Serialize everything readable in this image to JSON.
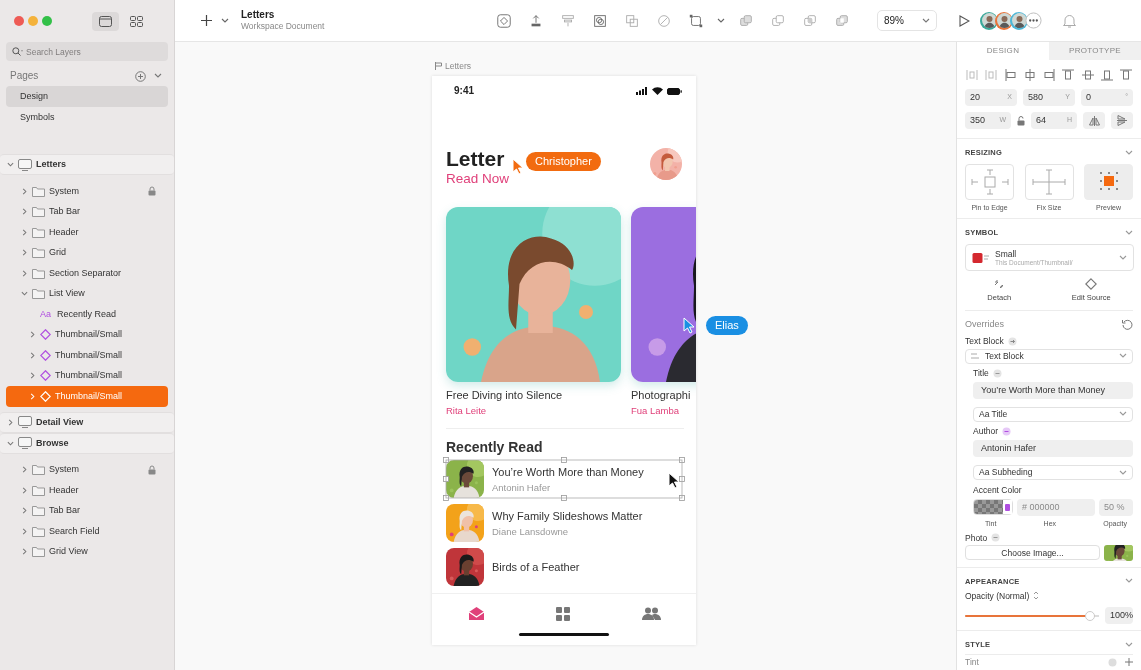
{
  "sidebar": {
    "search": {
      "placeholder": "Search Layers"
    },
    "pages_title": "Pages",
    "pages": [
      {
        "label": "Design",
        "selected": true
      },
      {
        "label": "Symbols",
        "selected": false
      }
    ],
    "layers": [
      {
        "name": "Letters",
        "kind": "artboard",
        "expanded": true,
        "selected": false,
        "locked": false,
        "children": [
          {
            "name": "System",
            "kind": "group",
            "expanded": false,
            "selected": false,
            "locked": true
          },
          {
            "name": "Tab Bar",
            "kind": "group",
            "expanded": false,
            "selected": false,
            "locked": false
          },
          {
            "name": "Header",
            "kind": "group",
            "expanded": false,
            "selected": false,
            "locked": false
          },
          {
            "name": "Grid",
            "kind": "group",
            "expanded": false,
            "selected": false,
            "locked": false
          },
          {
            "name": "Section Separator",
            "kind": "group",
            "expanded": false,
            "selected": false,
            "locked": false
          },
          {
            "name": "List View",
            "kind": "group",
            "expanded": true,
            "selected": false,
            "locked": false,
            "children": [
              {
                "name": "Recently Read",
                "kind": "text",
                "glyph": "Aa",
                "selected": false,
                "locked": false
              },
              {
                "name": "Thumbnail/Small",
                "kind": "symbol",
                "expanded": false,
                "selected": false,
                "locked": false
              },
              {
                "name": "Thumbnail/Small",
                "kind": "symbol",
                "expanded": false,
                "selected": false,
                "locked": false
              },
              {
                "name": "Thumbnail/Small",
                "kind": "symbol",
                "expanded": false,
                "selected": false,
                "locked": false
              },
              {
                "name": "Thumbnail/Small",
                "kind": "symbol",
                "expanded": false,
                "selected": true,
                "locked": false
              }
            ]
          }
        ]
      },
      {
        "name": "Detail View",
        "kind": "artboard",
        "expanded": false,
        "selected": false,
        "locked": false
      },
      {
        "name": "Browse",
        "kind": "artboard",
        "expanded": true,
        "selected": false,
        "locked": false,
        "children": [
          {
            "name": "System",
            "kind": "group",
            "expanded": false,
            "selected": false,
            "locked": true
          },
          {
            "name": "Header",
            "kind": "group",
            "expanded": false,
            "selected": false,
            "locked": false
          },
          {
            "name": "Tab Bar",
            "kind": "group",
            "expanded": false,
            "selected": false,
            "locked": false
          },
          {
            "name": "Search Field",
            "kind": "group",
            "expanded": false,
            "selected": false,
            "locked": false
          },
          {
            "name": "Grid View",
            "kind": "group",
            "expanded": false,
            "selected": false,
            "locked": false
          }
        ]
      }
    ]
  },
  "toolbar": {
    "document_title": "Letters",
    "document_subtitle": "Workspace Document",
    "zoom": "89%",
    "collaborators": [
      {
        "color": "#3aa89a"
      },
      {
        "color": "#e8743a"
      },
      {
        "color": "#4cb6d6"
      }
    ]
  },
  "canvas": {
    "artboard_title": "Letters",
    "phone": {
      "time": "9:41",
      "heading": "Letter",
      "subheading": "Read Now",
      "featured": [
        {
          "title": "Free Diving into Silence",
          "author": "Rita Leite"
        },
        {
          "title": "Photographi",
          "author": "Fua Lamba"
        }
      ],
      "section_title": "Recently Read",
      "list": [
        {
          "title": "You’re Worth More than Money",
          "author": "Antonin Hafer",
          "selected": true
        },
        {
          "title": "Why Family Slideshows Matter",
          "author": "Diane Lansdowne",
          "selected": false
        },
        {
          "title": "Birds of a Feather",
          "selected": false
        }
      ],
      "tabs": [
        {
          "kind": "envelope",
          "selected": true
        },
        {
          "kind": "grid",
          "selected": false
        },
        {
          "kind": "people",
          "selected": false
        }
      ]
    },
    "cursors": [
      {
        "name": "Christopher",
        "color": "#f26b0f"
      },
      {
        "name": "Elias",
        "color": "#1a8fe3"
      }
    ]
  },
  "inspector": {
    "tabs": [
      {
        "label": "DESIGN",
        "selected": true
      },
      {
        "label": "PROTOTYPE",
        "selected": false
      }
    ],
    "position": [
      {
        "value": "20",
        "unit": "X"
      },
      {
        "value": "580",
        "unit": "Y"
      },
      {
        "value": "0",
        "unit": "°"
      }
    ],
    "size": [
      {
        "value": "350",
        "unit": "W"
      },
      {
        "value": "64",
        "unit": "H"
      }
    ],
    "proportions_locked": false,
    "resizing": {
      "title": "RESIZING",
      "options": [
        "Pin to Edge",
        "Fix Size",
        "Preview"
      ]
    },
    "symbol": {
      "title": "SYMBOL",
      "name": "Small",
      "path": "This Document/Thumbnail/",
      "actions": [
        "Detach",
        "Edit Source"
      ]
    },
    "overrides": {
      "title": "Overrides",
      "text_block_label": "Text Block",
      "text_block_value": "Text Block",
      "fields": [
        {
          "label": "Title",
          "value": "You’re Worth More than Money",
          "style": "Aa Title",
          "highlighted": false
        },
        {
          "label": "Author",
          "value": "Antonin Hafer",
          "style": "Aa Subheding",
          "highlighted": true
        }
      ],
      "accent": {
        "label": "Accent Color",
        "hex_placeholder": "# 000000",
        "opacity_placeholder": "50 %",
        "captions": [
          "Tint",
          "Hex",
          "Opacity"
        ]
      },
      "photo": {
        "label": "Photo",
        "button": "Choose Image..."
      }
    },
    "appearance": {
      "title": "APPEARANCE",
      "opacity_label": "Opacity (Normal)",
      "level": 0.97,
      "reading": "100%"
    },
    "style": {
      "title": "STYLE",
      "first_row": "Tint"
    }
  }
}
